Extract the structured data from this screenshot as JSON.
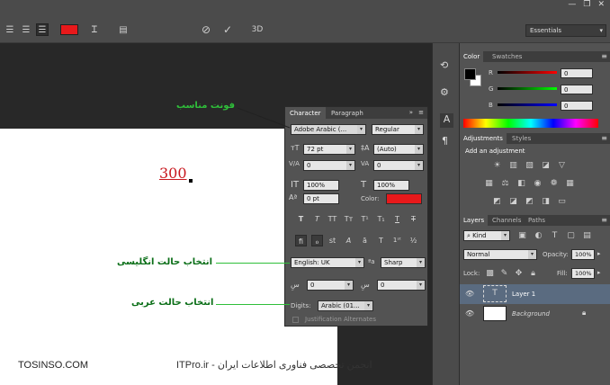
{
  "topbar": {
    "fill_color": "#e8191b",
    "threed_label": "3D",
    "workspace": "Essentials"
  },
  "canvas": {
    "sample_text": "300",
    "sample_color": "#c8161d"
  },
  "character_panel": {
    "tabs": [
      "Character",
      "Paragraph"
    ],
    "font_family": "Adobe Arabic (...",
    "font_style": "Regular",
    "font_size": "72 pt",
    "leading": "(Auto)",
    "kerning": "0",
    "tracking": "0",
    "vertical_scale": "100%",
    "horizontal_scale": "100%",
    "baseline_shift": "0 pt",
    "color_label": "Color:",
    "color_value": "#e8191b",
    "language": "English: UK",
    "antialias": "Sharp",
    "stretch_left": "0",
    "stretch_right": "0",
    "digits_label": "Digits:",
    "digits_value": "Arabic (01...",
    "justification_alternates": "Justification Alternates"
  },
  "color_panel": {
    "tabs": [
      "Color",
      "Swatches"
    ],
    "channels": [
      {
        "label": "R",
        "value": "0"
      },
      {
        "label": "G",
        "value": "0"
      },
      {
        "label": "B",
        "value": "0"
      }
    ]
  },
  "adjustments_panel": {
    "tabs": [
      "Adjustments",
      "Styles"
    ],
    "title": "Add an adjustment"
  },
  "layers_panel": {
    "tabs": [
      "Layers",
      "Channels",
      "Paths"
    ],
    "kind": "Kind",
    "blend_mode": "Normal",
    "opacity_label": "Opacity:",
    "opacity_value": "100%",
    "lock_label": "Lock:",
    "fill_label": "Fill:",
    "fill_value": "100%",
    "layers": [
      {
        "name": "Layer 1",
        "selected": true
      },
      {
        "name": "Background",
        "selected": false
      }
    ]
  },
  "annotations": {
    "font_label": "فونت مناسب",
    "english_label": "انتخاب حالت انگلیسی",
    "arabic_label": "انتخاب حالت عربی"
  },
  "footer": {
    "site": "TOSINSO.COM",
    "credit": "ITPro.ir - انجمن تخصصی فناوری اطلاعات ایران"
  }
}
